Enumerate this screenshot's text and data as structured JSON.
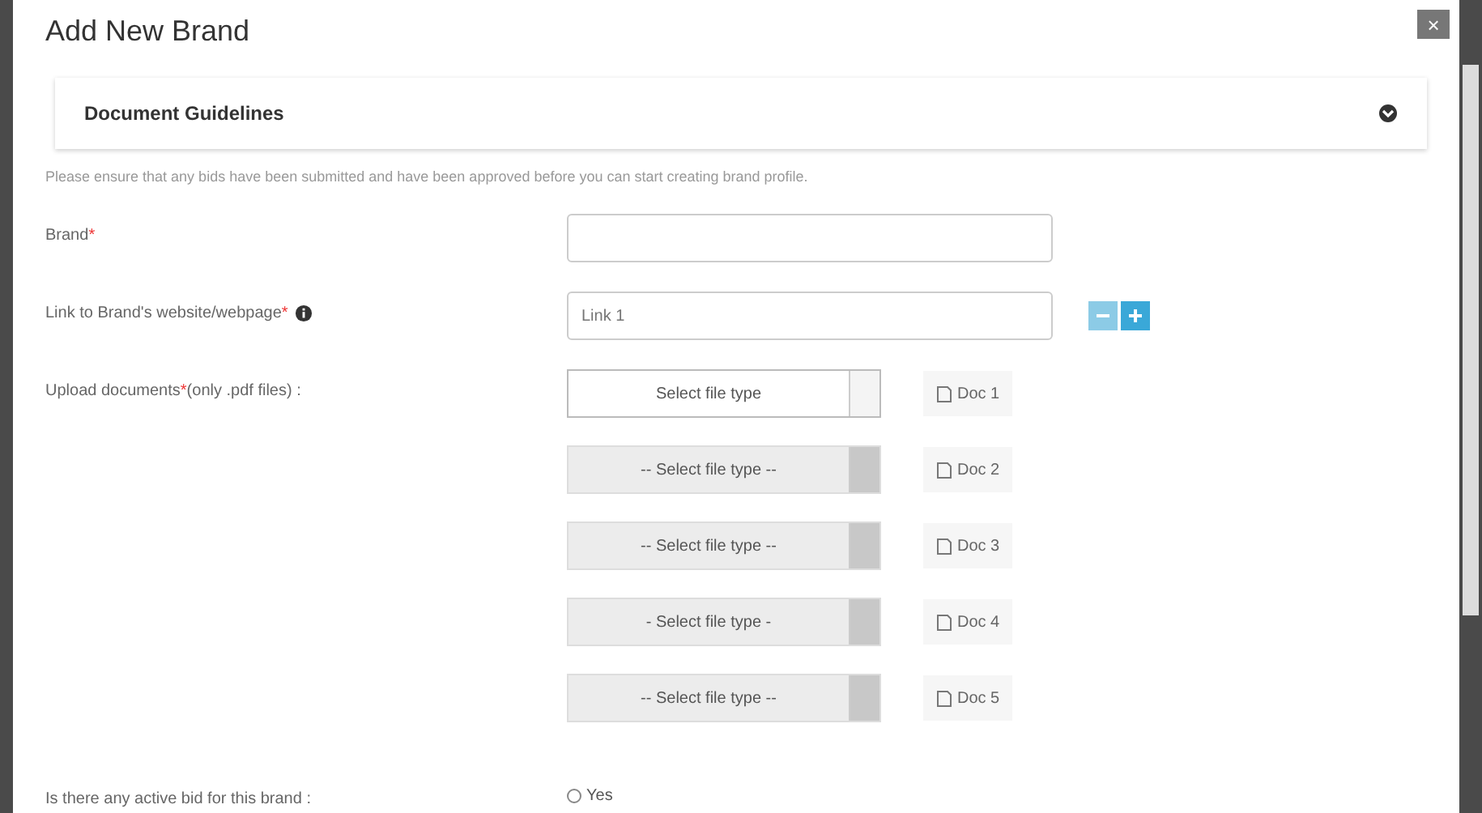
{
  "modal": {
    "title": "Add New Brand",
    "close": "×"
  },
  "guidelines": {
    "title": "Document Guidelines",
    "expanded": false
  },
  "notice": "Please ensure that any bids have been submitted and have been approved before you can start creating brand profile.",
  "fields": [
    {
      "kind": "text",
      "label": "Brand",
      "mark": "*"
    },
    {
      "kind": "link",
      "label": "Link to Brand's website/webpage",
      "mark": "*",
      "placeholder": "Link 1"
    },
    {
      "kind": "docs",
      "label": "Upload documents",
      "mark": "*",
      "note": "(only .pdf files) :",
      "docs": [
        {
          "select": "Select file type",
          "disabled": false,
          "button": "Doc 1"
        },
        {
          "select": "-- Select file type --",
          "disabled": true,
          "button": "Doc 2"
        },
        {
          "select": "-- Select file type --",
          "disabled": true,
          "button": "Doc 3"
        },
        {
          "select": "- Select file type -",
          "disabled": true,
          "button": "Doc 4"
        },
        {
          "select": "-- Select file type --",
          "disabled": true,
          "button": "Doc 5"
        }
      ]
    },
    {
      "kind": "radio",
      "label": "Is there any active bid for this brand :",
      "options": [
        {
          "label": "Yes",
          "selected": false
        }
      ]
    }
  ]
}
